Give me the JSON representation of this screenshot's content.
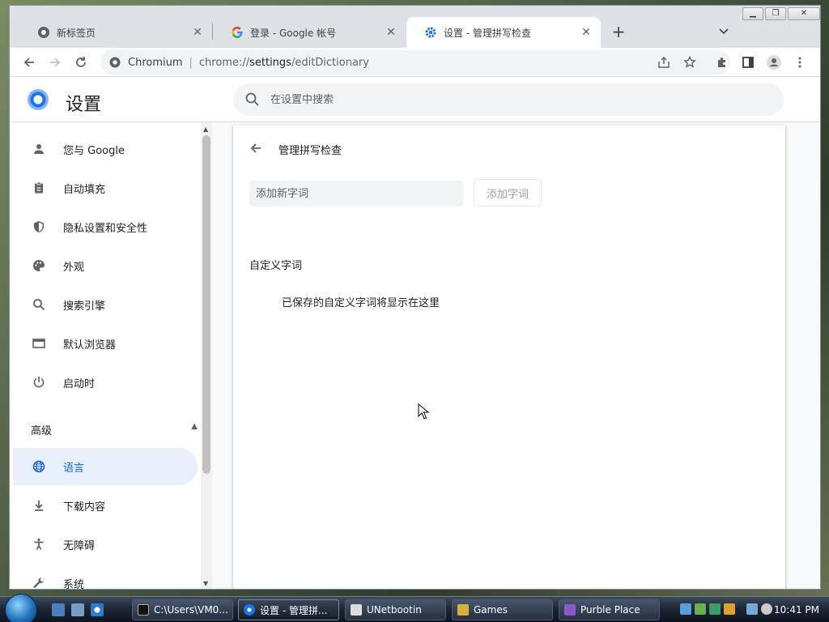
{
  "browser": {
    "tabs": [
      {
        "title": "新标签页",
        "active": false
      },
      {
        "title": "登录 - Google 帐号",
        "active": false
      },
      {
        "title": "设置 - 管理拼写检查",
        "active": true
      }
    ],
    "omnibox": {
      "site": "Chromium",
      "divider": "|",
      "scheme": "chrome://",
      "host": "settings",
      "path": "/editDictionary"
    }
  },
  "settings": {
    "title": "设置",
    "search_placeholder": "在设置中搜索",
    "sidebar": {
      "items": [
        {
          "label": "您与 Google",
          "icon": "person-icon"
        },
        {
          "label": "自动填充",
          "icon": "clipboard-icon"
        },
        {
          "label": "隐私设置和安全性",
          "icon": "shield-icon"
        },
        {
          "label": "外观",
          "icon": "palette-icon"
        },
        {
          "label": "搜索引擎",
          "icon": "search-icon"
        },
        {
          "label": "默认浏览器",
          "icon": "browser-icon"
        },
        {
          "label": "启动时",
          "icon": "power-icon"
        }
      ],
      "advanced_label": "高级",
      "advanced_items": [
        {
          "label": "语言",
          "icon": "globe-icon",
          "selected": true
        },
        {
          "label": "下载内容",
          "icon": "download-icon"
        },
        {
          "label": "无障碍",
          "icon": "accessibility-icon"
        },
        {
          "label": "系统",
          "icon": "wrench-icon"
        }
      ]
    },
    "page": {
      "title": "管理拼写检查",
      "input_placeholder": "添加新字词",
      "add_button": "添加字词",
      "custom_heading": "自定义字词",
      "empty_message": "已保存的自定义字词将显示在这里"
    }
  },
  "taskbar": {
    "buttons": [
      {
        "label": "C:\\Users\\VM0..."
      },
      {
        "label": "设置 - 管理拼..."
      },
      {
        "label": "UNetbootin"
      },
      {
        "label": "Games"
      },
      {
        "label": "Purble Place"
      }
    ],
    "clock": "10:41 PM"
  },
  "colors": {
    "accent": "#1a73e8",
    "selected_bg": "#e8f0fe",
    "selected_text": "#1967d2"
  }
}
